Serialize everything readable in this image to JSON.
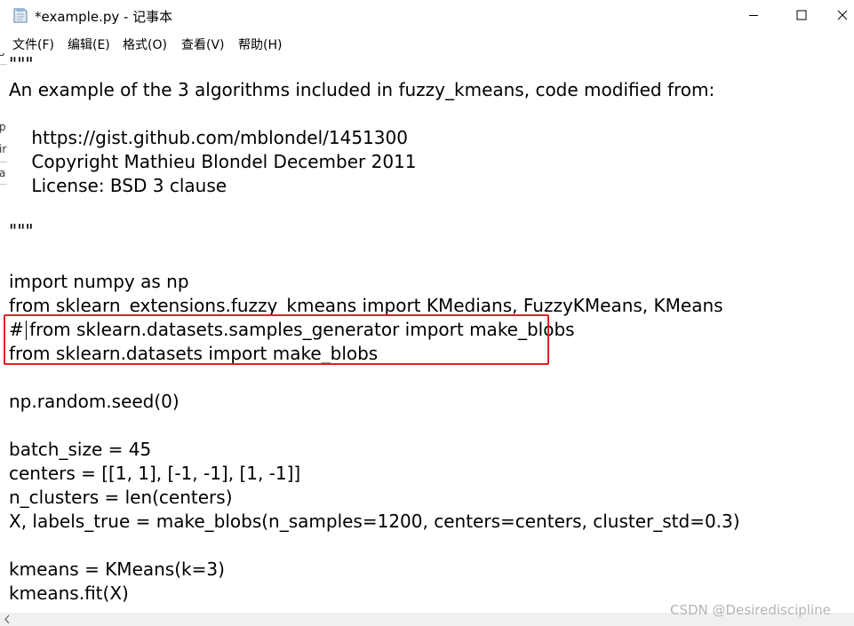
{
  "window": {
    "title": "*example.py - 记事本"
  },
  "menu": [
    {
      "label": "文件(F)"
    },
    {
      "label": "编辑(E)"
    },
    {
      "label": "格式(O)"
    },
    {
      "label": "查看(V)"
    },
    {
      "label": "帮助(H)"
    }
  ],
  "editor": {
    "left_strip_chars": [
      "s",
      "p",
      "ir",
      "a"
    ],
    "lines": [
      "\"\"\"",
      "An example of the 3 algorithms included in fuzzy_kmeans, code modified from:",
      "",
      "    https://gist.github.com/mblondel/1451300",
      "    Copyright Mathieu Blondel December 2011",
      "    License: BSD 3 clause",
      "",
      "\"\"\"",
      "",
      "",
      "import numpy as np",
      "from sklearn_extensions.fuzzy_kmeans import KMedians, FuzzyKMeans, KMeans",
      "# from sklearn.datasets.samples_generator import make_blobs",
      "from sklearn.datasets import make_blobs",
      "",
      "np.random.seed(0)",
      "",
      "batch_size = 45",
      "centers = [[1, 1], [-1, -1], [1, -1]]",
      "n_clusters = len(centers)",
      "X, labels_true = make_blobs(n_samples=1200, centers=centers, cluster_std=0.3)",
      "",
      "kmeans = KMeans(k=3)",
      "kmeans.fit(X)"
    ]
  },
  "watermark": "CSDN @Desirediscipline",
  "colors": {
    "highlight_border": "#e02020",
    "watermark": "#b4b4b4"
  }
}
